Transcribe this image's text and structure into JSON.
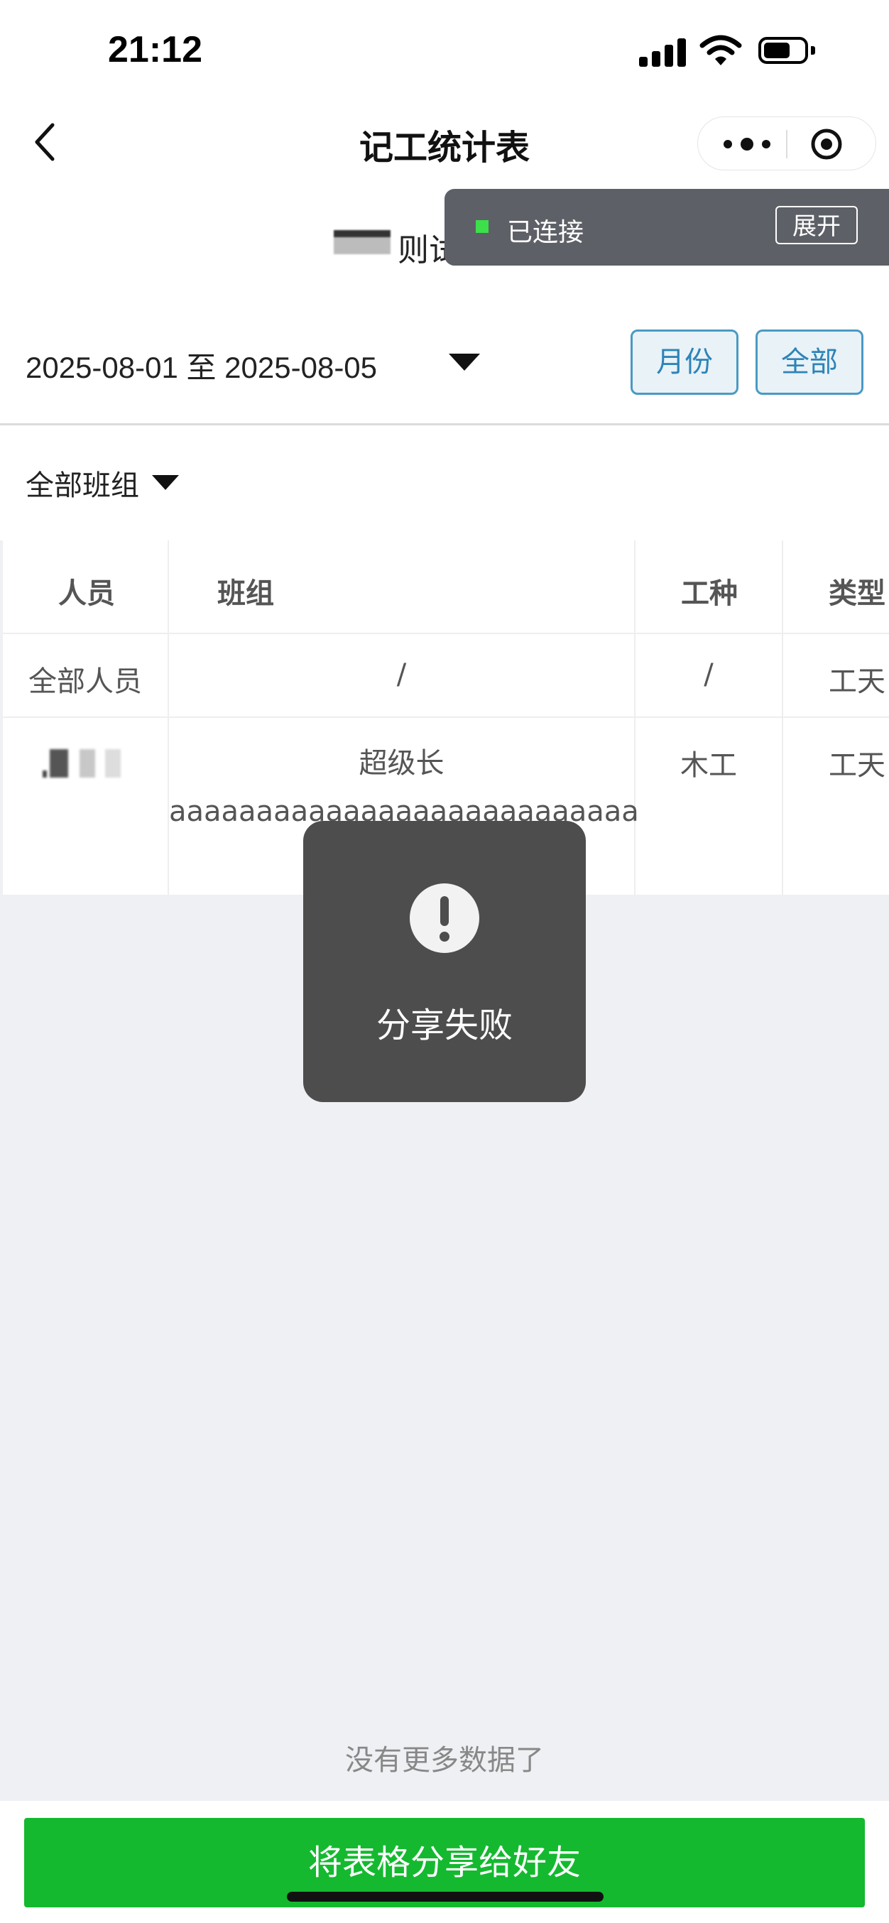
{
  "status_bar": {
    "time": "21:12"
  },
  "nav": {
    "title": "记工统计表"
  },
  "project": {
    "name": "则试项目"
  },
  "connection": {
    "text": "已连接",
    "expand_label": "展开"
  },
  "filters": {
    "date_range": "2025-08-01 至 2025-08-05",
    "month_label": "月份",
    "all_label": "全部",
    "team_label": "全部班组"
  },
  "table": {
    "headers": [
      "人员",
      "班组",
      "工种",
      "类型"
    ],
    "rows": [
      {
        "person": "全部人员",
        "team": "/",
        "trade": "/",
        "type": "工天"
      },
      {
        "person": "",
        "team": "超级长\naaaaaaaaaaaaaaaaaaaaaaaaaaa",
        "trade": "木工",
        "type": "工天"
      }
    ]
  },
  "toast": {
    "text": "分享失败",
    "icon": "exclamation-icon"
  },
  "footer": {
    "no_more": "没有更多数据了",
    "share_label": "将表格分享给好友"
  },
  "colors": {
    "primary_green": "#14b92f",
    "accent_blue": "#2d84b8",
    "toast_bg": "#4d4d4d",
    "connected_dot": "#3ce04a"
  }
}
